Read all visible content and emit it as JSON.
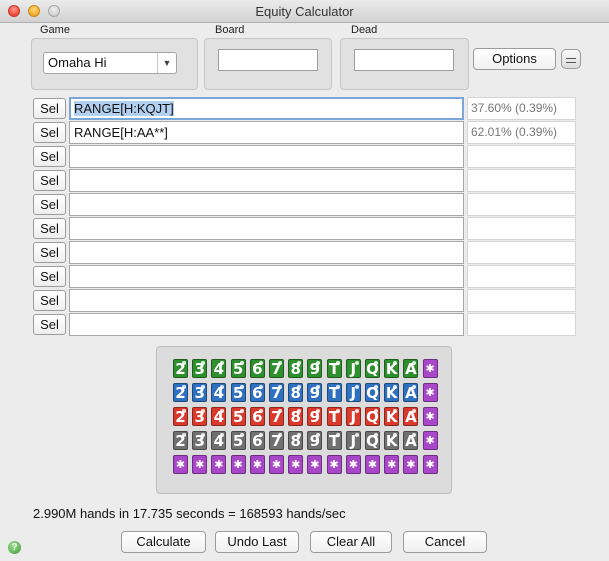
{
  "window": {
    "title": "Equity Calculator"
  },
  "game": {
    "label": "Game",
    "selected": "Omaha Hi"
  },
  "board": {
    "label": "Board",
    "value": ""
  },
  "dead": {
    "label": "Dead",
    "value": ""
  },
  "options_label": "Options",
  "sel_label": "Sel",
  "players": [
    {
      "range": "RANGE[H:KQJT]",
      "equity": "37.60% (0.39%)"
    },
    {
      "range": "RANGE[H:AA**]",
      "equity": "62.01% (0.39%)"
    },
    {
      "range": "",
      "equity": ""
    },
    {
      "range": "",
      "equity": ""
    },
    {
      "range": "",
      "equity": ""
    },
    {
      "range": "",
      "equity": ""
    },
    {
      "range": "",
      "equity": ""
    },
    {
      "range": "",
      "equity": ""
    },
    {
      "range": "",
      "equity": ""
    },
    {
      "range": "",
      "equity": ""
    }
  ],
  "card_picker": {
    "ranks": [
      "2",
      "3",
      "4",
      "5",
      "6",
      "7",
      "8",
      "9",
      "T",
      "J",
      "Q",
      "K",
      "A"
    ],
    "wild_symbol": "✱",
    "suit_colors": {
      "hearts": "#2f8f2f",
      "spades": "#2f70c0",
      "clubs": "#d93a2b",
      "diamonds": "#707070",
      "wild": "#a848c8"
    }
  },
  "status": "2.990M hands in 17.735 seconds = 168593 hands/sec",
  "buttons": {
    "calculate": "Calculate",
    "undo": "Undo Last",
    "clear": "Clear All",
    "cancel": "Cancel"
  },
  "help_glyph": "?"
}
